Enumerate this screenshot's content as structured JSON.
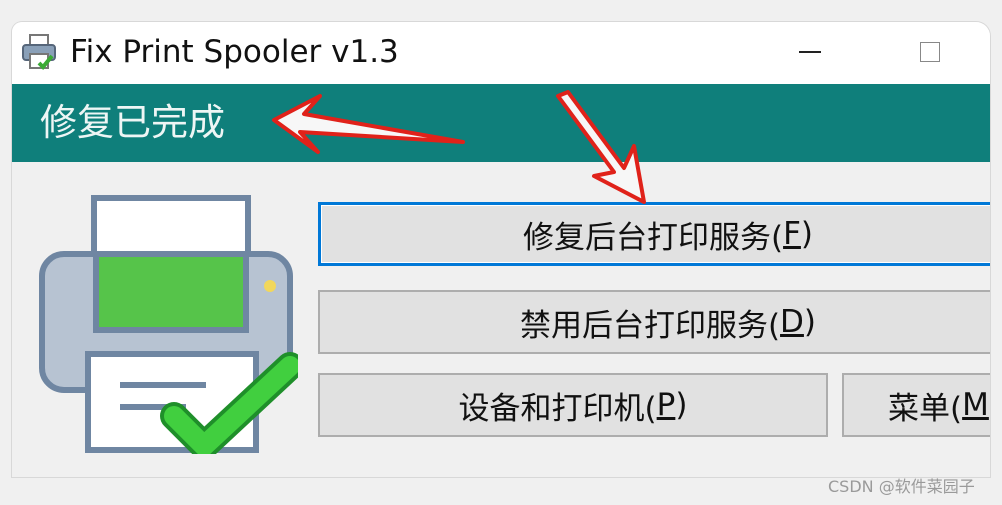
{
  "window": {
    "title": "Fix Print Spooler v1.3",
    "app_icon": "printer-icon"
  },
  "status": {
    "text": "修复已完成"
  },
  "buttons": {
    "repair": {
      "prefix": "修复后台打印服务(",
      "key": "F",
      "suffix": ")"
    },
    "disable": {
      "prefix": "禁用后台打印服务(",
      "key": "D",
      "suffix": ")"
    },
    "devices": {
      "prefix": "设备和打印机(",
      "key": "P",
      "suffix": ")"
    },
    "menu": {
      "prefix": "菜单(",
      "key": "M",
      "suffix": ""
    }
  },
  "watermark": "CSDN @软件菜园子",
  "colors": {
    "status_bar": "#0f7f7b",
    "focus_border": "#0078d7",
    "annotation_arrow": "#e0221a",
    "checkmark": "#2fbf3a"
  },
  "icons": {
    "minimize": "minimize-icon",
    "maximize": "maximize-icon",
    "illustration": "printer-success-icon"
  }
}
